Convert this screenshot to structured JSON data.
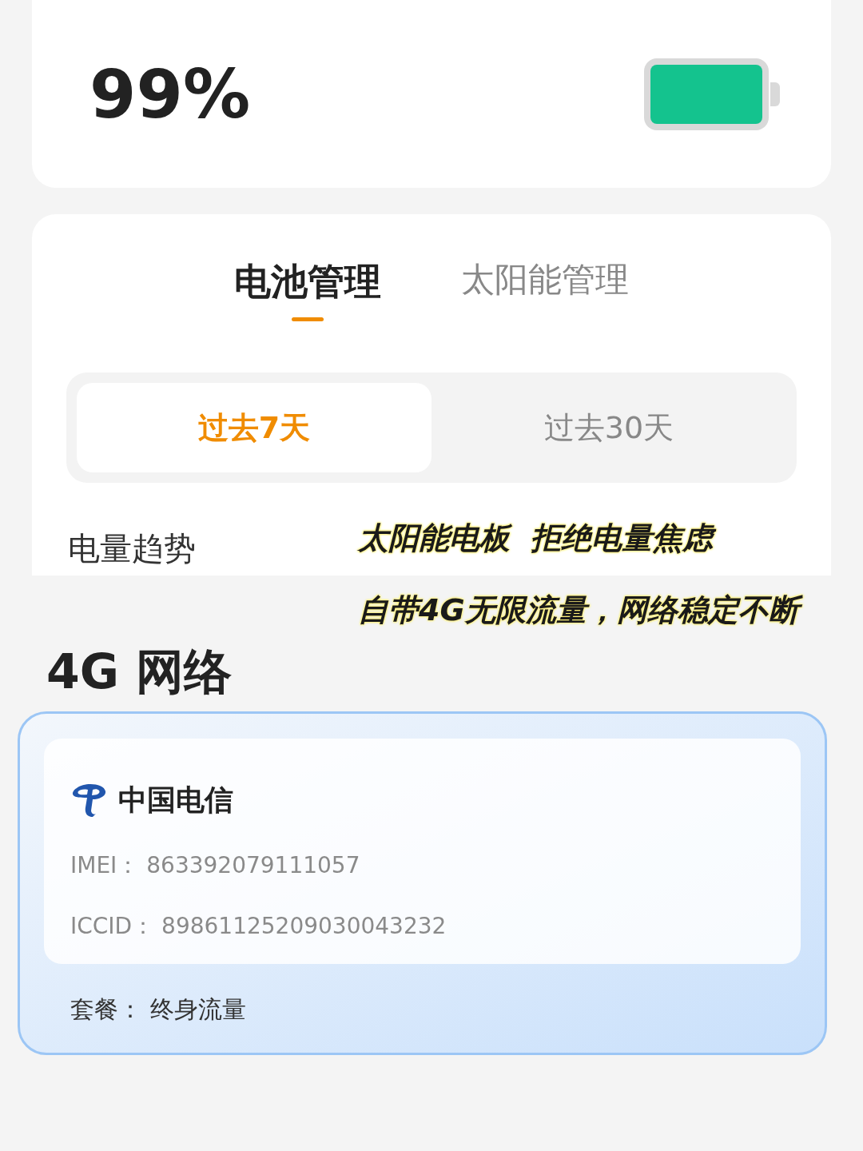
{
  "battery": {
    "percent": "99%"
  },
  "tabs": [
    {
      "label": "电池管理",
      "selected": true
    },
    {
      "label": "太阳能管理",
      "selected": false
    }
  ],
  "ranges": [
    {
      "label": "过去7天",
      "selected": true
    },
    {
      "label": "过去30天",
      "selected": false
    }
  ],
  "trend_title": "电量趋势",
  "captions": [
    "太阳能电板  拒绝电量焦虑",
    "自带4G无限流量，网络稳定不断"
  ],
  "network": {
    "title": "4G 网络",
    "carrier": "中国电信",
    "imei": "IMEI：  863392079111057",
    "iccid": "ICCID：  89861125209030043232",
    "plan": "套餐：  终身流量"
  }
}
